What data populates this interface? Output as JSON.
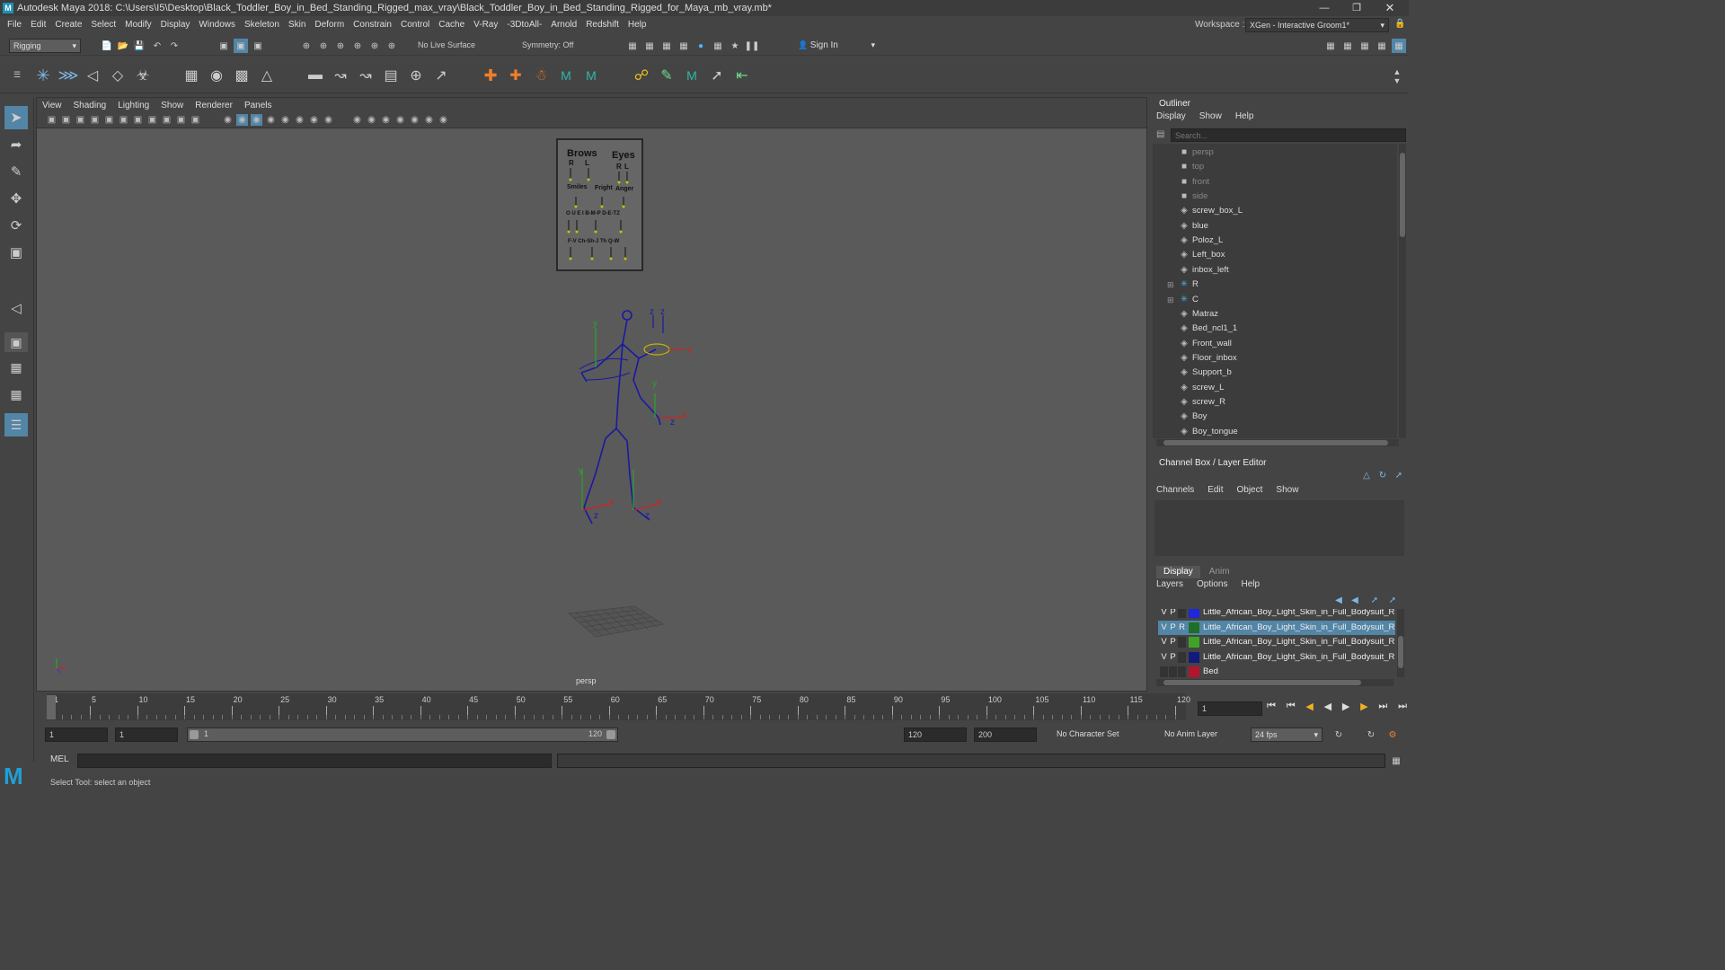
{
  "window": {
    "title": "Autodesk Maya 2018: C:\\Users\\I5\\Desktop\\Black_Toddler_Boy_in_Bed_Standing_Rigged_max_vray\\Black_Toddler_Boy_in_Bed_Standing_Rigged_for_Maya_mb_vray.mb*",
    "workspace_label": "Workspace :",
    "workspace_value": "XGen - Interactive Groom1*"
  },
  "menus": [
    "File",
    "Edit",
    "Create",
    "Select",
    "Modify",
    "Display",
    "Windows",
    "Skeleton",
    "Skin",
    "Deform",
    "Constrain",
    "Control",
    "Cache",
    "V-Ray",
    "-3DtoAll-",
    "Arnold",
    "Redshift",
    "Help"
  ],
  "status": {
    "mode": "Rigging",
    "live_surface": "No Live Surface",
    "symmetry": "Symmetry: Off",
    "sign_in": "Sign In"
  },
  "viewport": {
    "menus": [
      "View",
      "Shading",
      "Lighting",
      "Show",
      "Renderer",
      "Panels"
    ],
    "camera": "persp",
    "ui_panel": {
      "brows": "Brows",
      "eyes": "Eyes",
      "r": "R",
      "l": "L",
      "r2": "R",
      "l2": "L",
      "smile": "Smiles",
      "fright": "Fright",
      "anger": "Anger",
      "row3": "O U E I  B-M-P  D-E-TZ",
      "row4": "F-V  Ch-Sh-J  Th  Q-W"
    },
    "axis": {
      "x": "x",
      "y": "y",
      "z": "z"
    }
  },
  "outliner": {
    "title": "Outliner",
    "menus": [
      "Display",
      "Show",
      "Help"
    ],
    "search_placeholder": "Search...",
    "items": [
      {
        "label": "persp",
        "icon": "camera-icon",
        "dim": true
      },
      {
        "label": "top",
        "icon": "camera-icon",
        "dim": true
      },
      {
        "label": "front",
        "icon": "camera-icon",
        "dim": true
      },
      {
        "label": "side",
        "icon": "camera-icon",
        "dim": true
      },
      {
        "label": "screw_box_L",
        "icon": "mesh-icon"
      },
      {
        "label": "blue",
        "icon": "mesh-icon"
      },
      {
        "label": "Poloz_L",
        "icon": "mesh-icon"
      },
      {
        "label": "Left_box",
        "icon": "mesh-icon"
      },
      {
        "label": "inbox_left",
        "icon": "mesh-icon"
      },
      {
        "label": "R",
        "icon": "joint-icon",
        "expand": true
      },
      {
        "label": "C",
        "icon": "joint-icon",
        "expand": true
      },
      {
        "label": "Matraz",
        "icon": "mesh-icon"
      },
      {
        "label": "Bed_ncl1_1",
        "icon": "mesh-icon"
      },
      {
        "label": "Front_wall",
        "icon": "mesh-icon"
      },
      {
        "label": "Floor_inbox",
        "icon": "mesh-icon"
      },
      {
        "label": "Support_b",
        "icon": "mesh-icon"
      },
      {
        "label": "screw_L",
        "icon": "mesh-icon"
      },
      {
        "label": "screw_R",
        "icon": "mesh-icon"
      },
      {
        "label": "Boy",
        "icon": "mesh-icon"
      },
      {
        "label": "Boy_tongue",
        "icon": "mesh-icon"
      }
    ]
  },
  "channelbox": {
    "title": "Channel Box / Layer Editor",
    "menus": [
      "Channels",
      "Edit",
      "Object",
      "Show"
    ],
    "tabs": [
      "Display",
      "Anim"
    ],
    "layer_menus": [
      "Layers",
      "Options",
      "Help"
    ],
    "layers": [
      {
        "v": "V",
        "p": "P",
        "r": "",
        "name": "Little_African_Boy_Light_Skin_in_Full_Bodysuit_Rigg",
        "color": "#1e28d8",
        "selected": false
      },
      {
        "v": "V",
        "p": "P",
        "r": "R",
        "name": "Little_African_Boy_Light_Skin_in_Full_Bodysuit_Rigg",
        "color": "#1f6e2a",
        "selected": true
      },
      {
        "v": "V",
        "p": "P",
        "r": "",
        "name": "Little_African_Boy_Light_Skin_in_Full_Bodysuit_Rigg",
        "color": "#3fa32a",
        "selected": false
      },
      {
        "v": "V",
        "p": "P",
        "r": "",
        "name": "Little_African_Boy_Light_Skin_in_Full_Bodysuit_Rigg",
        "color": "#121b7a",
        "selected": false
      },
      {
        "v": "",
        "p": "",
        "r": "",
        "name": "Bed",
        "color": "#b3142e",
        "selected": false
      }
    ]
  },
  "timeline": {
    "ticks": [
      "1",
      "5",
      "10",
      "15",
      "20",
      "25",
      "30",
      "35",
      "40",
      "45",
      "50",
      "55",
      "60",
      "65",
      "70",
      "75",
      "80",
      "85",
      "90",
      "95",
      "100",
      "105",
      "110",
      "115",
      "120"
    ],
    "current_frame": "1"
  },
  "range": {
    "start": "1",
    "anim_start": "1",
    "slider_start": "1",
    "slider_end": "120",
    "anim_end": "120",
    "end": "200",
    "character_set": "No Character Set",
    "anim_layer": "No Anim Layer",
    "fps": "24 fps"
  },
  "command": {
    "label": "MEL"
  },
  "help": {
    "text": "Select Tool: select an object"
  }
}
